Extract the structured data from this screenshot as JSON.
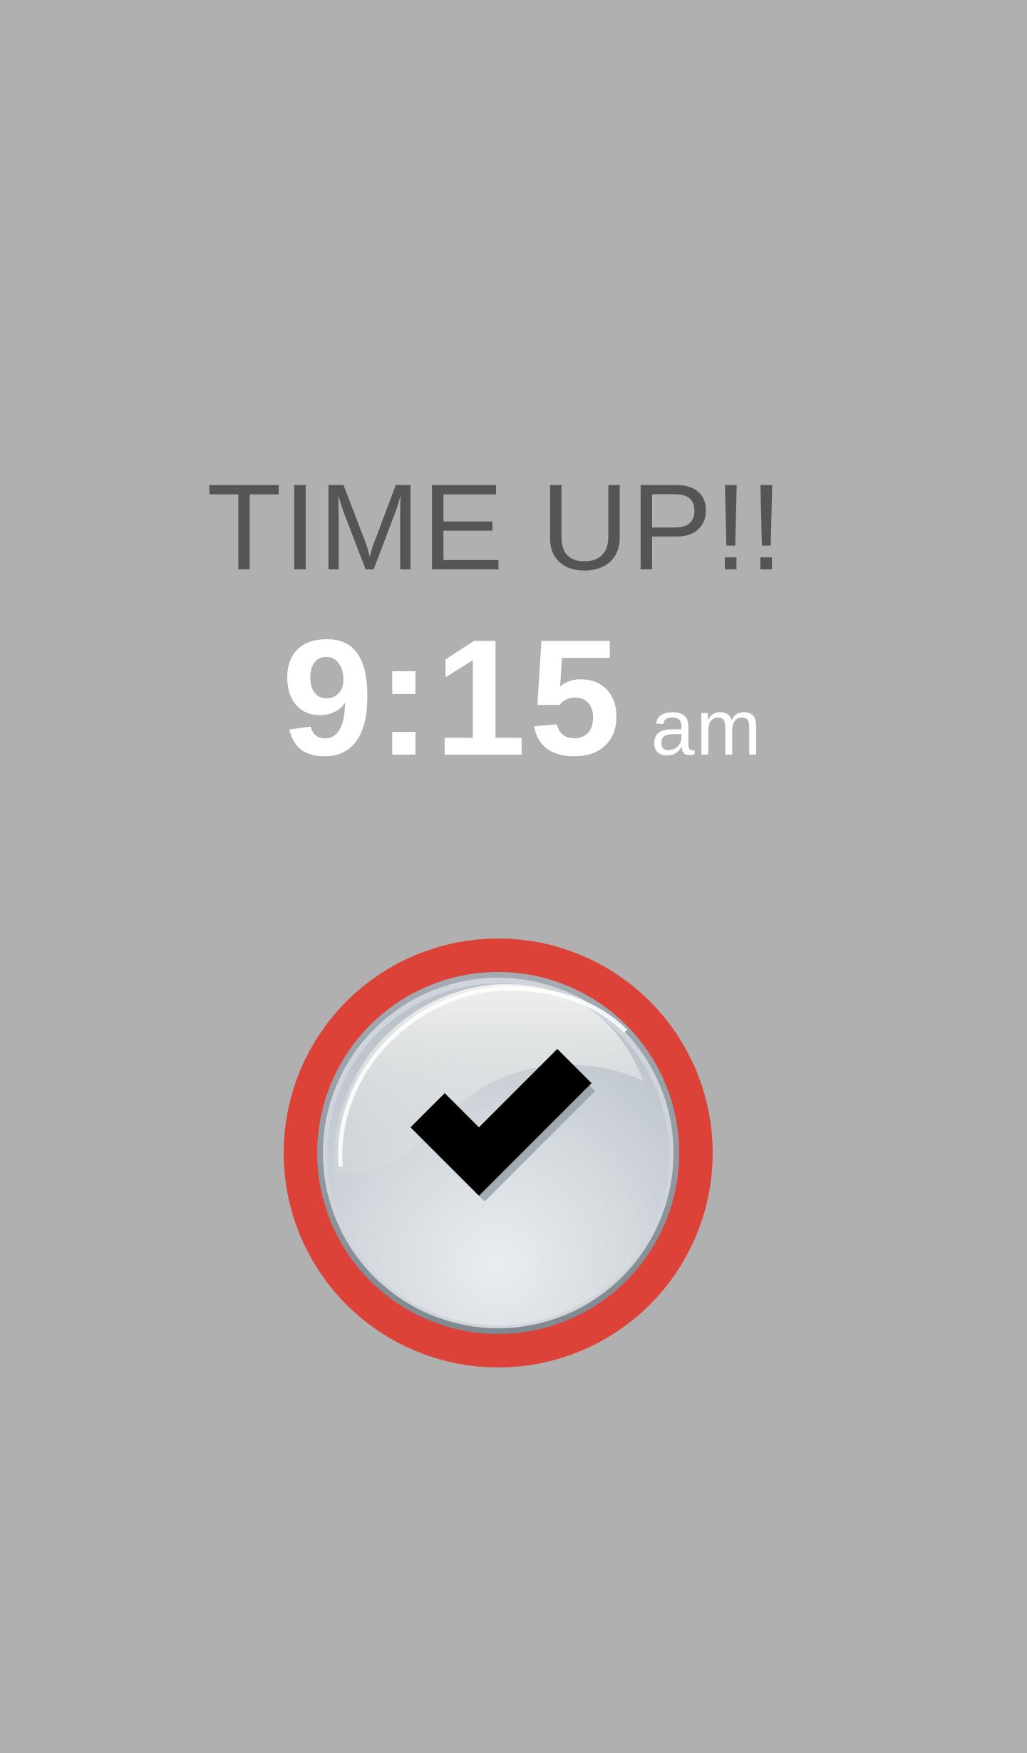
{
  "alarm": {
    "title": "TIME UP!!",
    "time": "9:15",
    "period": "am"
  },
  "confirm": {
    "icon": "checkmark-icon",
    "ring_color": "#dc4238"
  },
  "colors": {
    "background": "#b0b0b0",
    "title_text": "#555555",
    "time_text": "#ffffff"
  }
}
